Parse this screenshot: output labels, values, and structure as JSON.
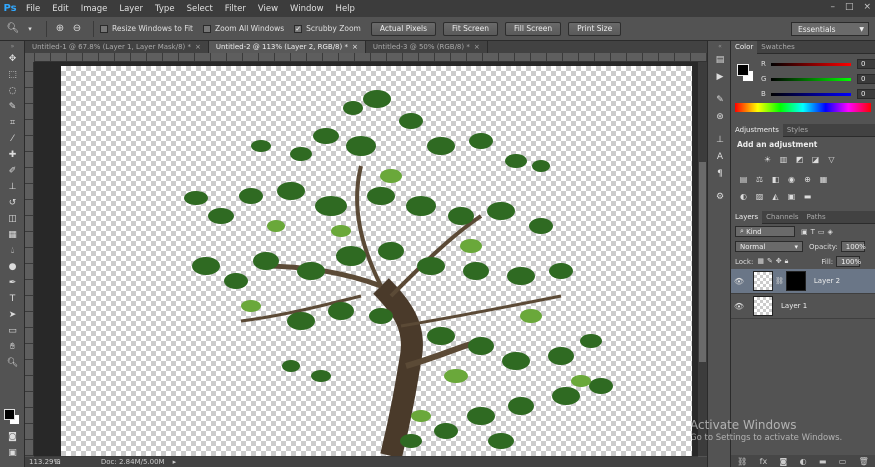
{
  "app": {
    "logo": "Ps"
  },
  "menu": [
    "File",
    "Edit",
    "Image",
    "Layer",
    "Type",
    "Select",
    "Filter",
    "View",
    "Window",
    "Help"
  ],
  "window_buttons": [
    "–",
    "□",
    "×"
  ],
  "options": {
    "resize_windows": "Resize Windows to Fit",
    "zoom_all": "Zoom All Windows",
    "scrubby_zoom": "Scrubby Zoom",
    "actual_pixels": "Actual Pixels",
    "fit_screen": "Fit Screen",
    "fill_screen": "Fill Screen",
    "print_size": "Print Size",
    "workspace": "Essentials"
  },
  "doc_tabs": [
    {
      "label": "Untitled-1 @ 67.8% (Layer 1, Layer Mask/8) *"
    },
    {
      "label": "Untitled-2 @ 113% (Layer 2, RGB/8) *"
    },
    {
      "label": "Untitled-3 @ 50% (RGB/8) *"
    }
  ],
  "status": {
    "zoom": "113.29%",
    "doc": "Doc: 2.84M/5.00M"
  },
  "color_panel": {
    "tabs": [
      "Color",
      "Swatches"
    ],
    "r": {
      "label": "R",
      "value": "0"
    },
    "g": {
      "label": "G",
      "value": "0"
    },
    "b": {
      "label": "B",
      "value": "0"
    }
  },
  "adjust_panel": {
    "tabs": [
      "Adjustments",
      "Styles"
    ],
    "title": "Add an adjustment"
  },
  "layers_panel": {
    "tabs": [
      "Layers",
      "Channels",
      "Paths"
    ],
    "kind": "Kind",
    "blend": "Normal",
    "opacity_label": "Opacity:",
    "opacity": "100%",
    "lock_label": "Lock:",
    "fill_label": "Fill:",
    "fill": "100%",
    "layers": [
      {
        "name": "Layer 2"
      },
      {
        "name": "Layer 1"
      }
    ]
  },
  "watermark": {
    "line1": "Activate Windows",
    "line2": "Go to Settings to activate Windows."
  }
}
